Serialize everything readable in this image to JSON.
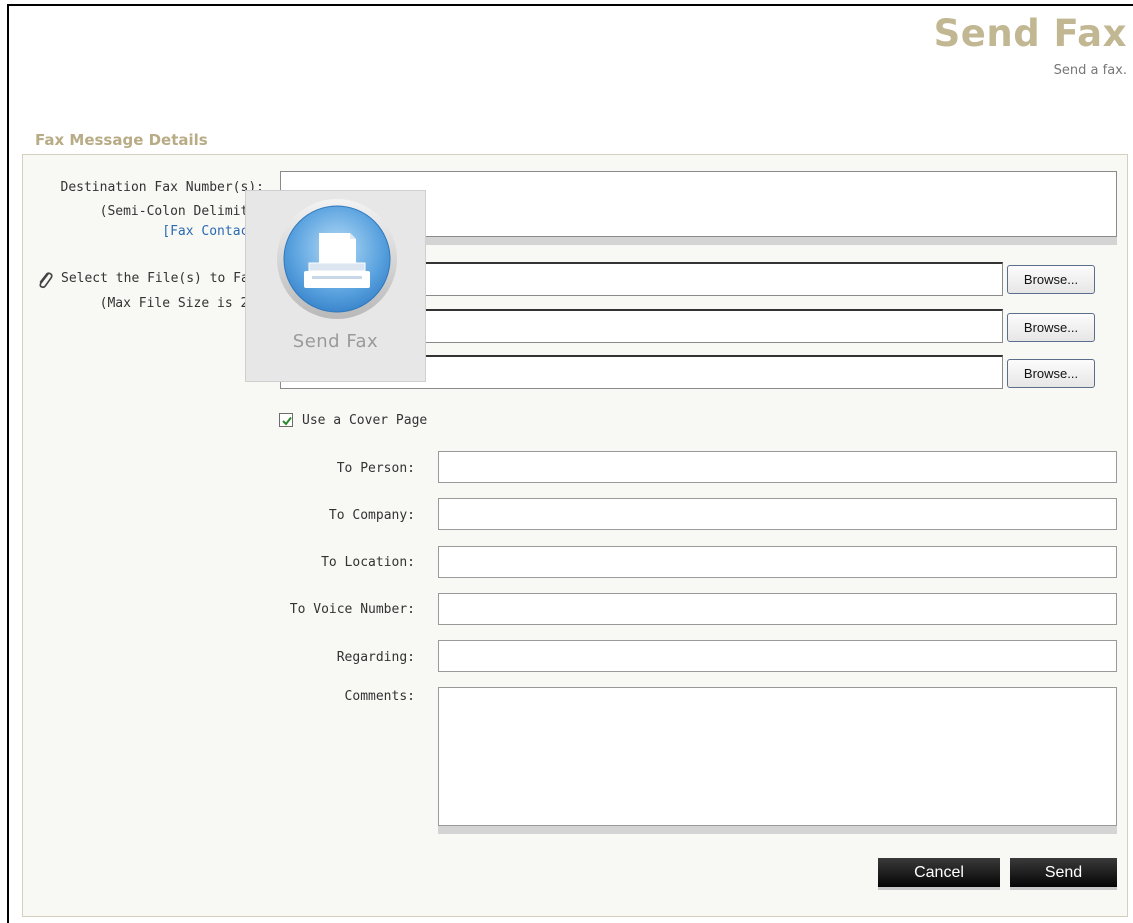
{
  "header": {
    "title": "Send Fax",
    "subtitle": "Send a fax."
  },
  "section": {
    "title": "Fax Message Details"
  },
  "destination": {
    "label": "Destination Fax Number(s):",
    "hint": "(Semi-Colon Delimited",
    "contacts_link": "[Fax Contacts",
    "value": ""
  },
  "files": {
    "label": "Select the File(s) to Fax",
    "hint": "(Max File Size is 2MB",
    "browse_label": "Browse...",
    "inputs": [
      "",
      "",
      ""
    ]
  },
  "overlay": {
    "label": "Send Fax",
    "icon": "fax-machine-icon"
  },
  "cover_page": {
    "label": "Use a Cover Page",
    "checked": true
  },
  "cover_fields": {
    "to_person": "To Person:",
    "to_company": "To Company:",
    "to_location": "To Location:",
    "to_voice_number": "To Voice Number:",
    "regarding": "Regarding:",
    "comments": "Comments:"
  },
  "actions": {
    "cancel": "Cancel",
    "send": "Send"
  },
  "colors": {
    "title": "#c2b793",
    "section_title": "#b8ac86",
    "link": "#2a6bb0",
    "button_dark": "#111111"
  }
}
